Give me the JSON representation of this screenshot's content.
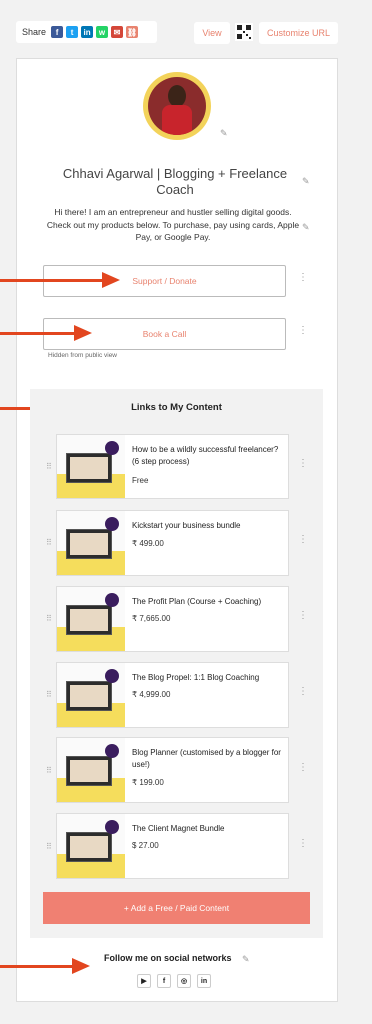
{
  "toolbar": {
    "share_label": "Share",
    "share_icons": [
      {
        "name": "facebook-icon",
        "glyph": "f",
        "color": "#3b5998"
      },
      {
        "name": "twitter-icon",
        "glyph": "t",
        "color": "#1da1f2"
      },
      {
        "name": "linkedin-icon",
        "glyph": "in",
        "color": "#0077b5"
      },
      {
        "name": "whatsapp-icon",
        "glyph": "w",
        "color": "#25d366"
      },
      {
        "name": "email-icon",
        "glyph": "✉",
        "color": "#d44638"
      },
      {
        "name": "link-icon",
        "glyph": "⛓",
        "color": "#e8836f"
      }
    ],
    "view_label": "View",
    "customize_label": "Customize URL"
  },
  "profile": {
    "name": "Chhavi Agarwal | Blogging + Freelance Coach",
    "bio": "Hi there! I am an entrepreneur and hustler selling digital goods. Check out my products below. To purchase, pay using cards, Apple Pay, or Google Pay."
  },
  "links": [
    {
      "label": "Support / Donate"
    },
    {
      "label": "Book a Call"
    }
  ],
  "hidden_note": "Hidden from public view",
  "content_section": {
    "title": "Links to My Content",
    "items": [
      {
        "title": "How to be a wildly successful freelancer? (6 step process)",
        "price": "Free"
      },
      {
        "title": "Kickstart your business bundle",
        "price": "₹ 499.00"
      },
      {
        "title": "The Profit Plan (Course + Coaching)",
        "price": "₹ 7,665.00"
      },
      {
        "title": "The Blog Propel: 1:1 Blog Coaching",
        "price": "₹ 4,999.00"
      },
      {
        "title": "Blog Planner (customised by a blogger for use!)",
        "price": "₹ 199.00"
      },
      {
        "title": "The Client Magnet Bundle",
        "price": "$ 27.00"
      }
    ],
    "add_button": "+ Add a Free / Paid Content"
  },
  "social": {
    "title": "Follow me on social networks",
    "icons": [
      {
        "name": "youtube-icon",
        "glyph": "▶"
      },
      {
        "name": "facebook-icon",
        "glyph": "f"
      },
      {
        "name": "instagram-icon",
        "glyph": "◎"
      },
      {
        "name": "linkedin-icon",
        "glyph": "in"
      }
    ]
  },
  "colors": {
    "accent": "#e8836f",
    "button": "#f08072",
    "arrow": "#e2461f",
    "avatar_ring": "#f3d35a"
  }
}
